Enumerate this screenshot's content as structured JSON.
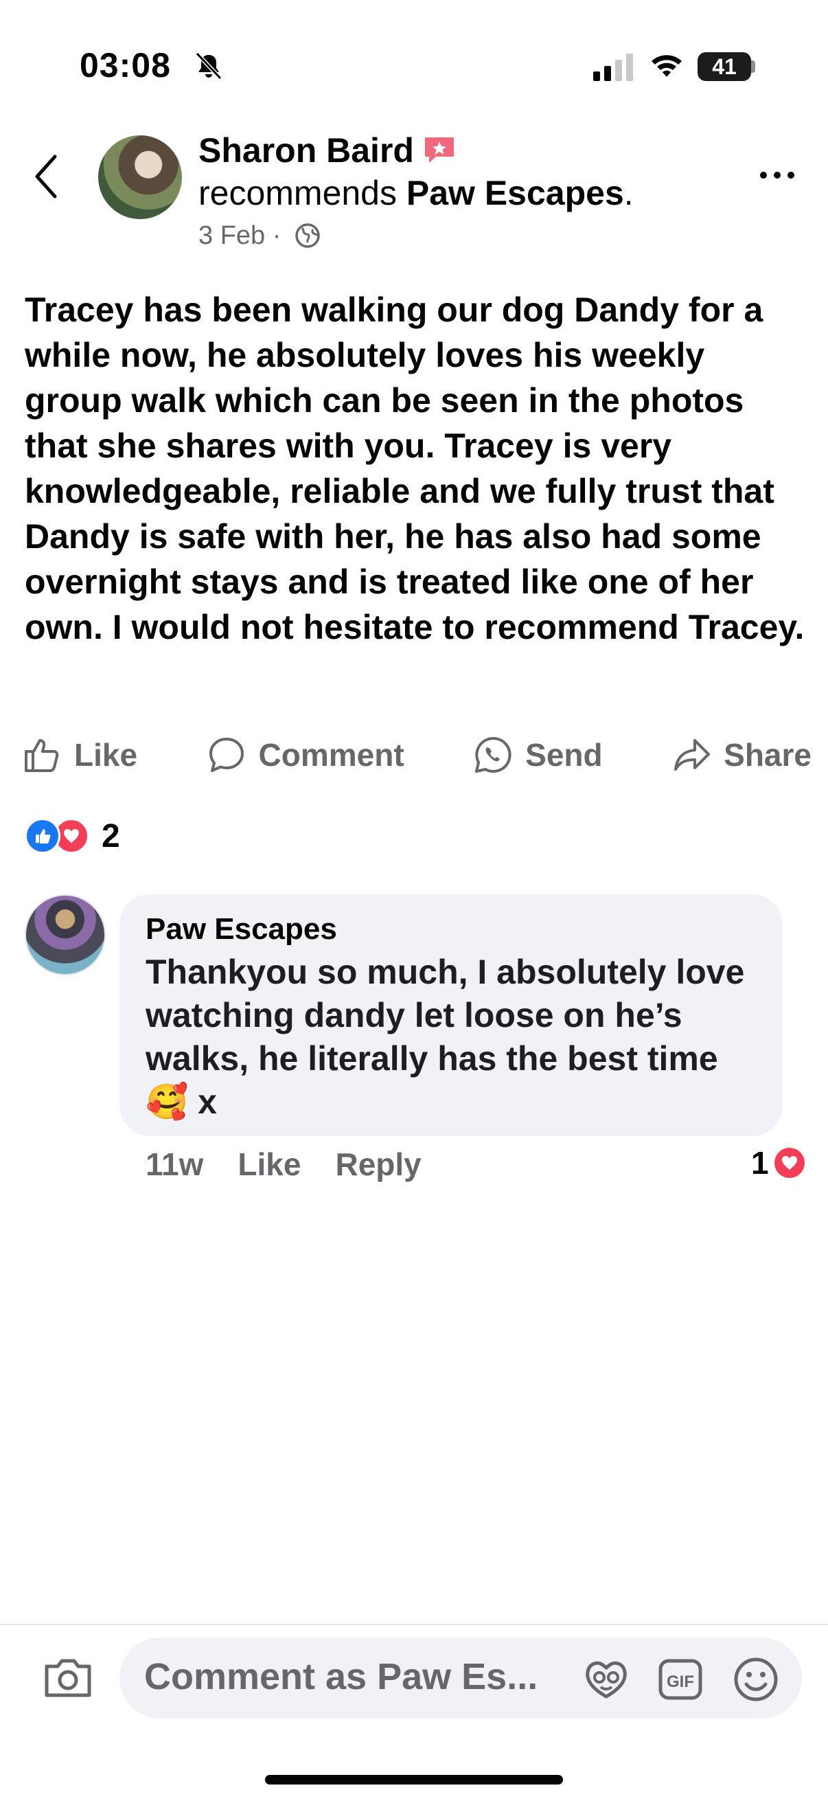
{
  "status_bar": {
    "time": "03:08",
    "battery": "41"
  },
  "post": {
    "author": "Sharon Baird",
    "recommends_prefix": "recommends ",
    "page_name": "Paw Escapes",
    "recommends_suffix": ".",
    "date": "3 Feb ·",
    "body": "Tracey has been walking our dog Dandy for a while now, he absolutely loves his weekly group walk which can be seen in the photos that she shares with you. Tracey is very knowledgeable, reliable and we fully trust that Dandy is safe with her, he has also had some overnight stays and is treated like one of her own. I would not hesitate to recommend Tracey."
  },
  "actions": {
    "like": "Like",
    "comment": "Comment",
    "send": "Send",
    "share": "Share"
  },
  "reactions": {
    "count": "2"
  },
  "comment": {
    "author": "Paw Escapes",
    "text": "Thankyou so much, I absolutely love watching dandy let loose on he’s walks, he literally has the best time 🥰 x",
    "time_ago": "11w",
    "like": "Like",
    "reply": "Reply",
    "reaction_count": "1"
  },
  "composer": {
    "placeholder": "Comment as Paw Es..."
  },
  "colors": {
    "like_blue": "#1877f2",
    "love_red": "#f33e58",
    "meta_gray": "#65676b",
    "bubble_bg": "#f0f2f5"
  }
}
